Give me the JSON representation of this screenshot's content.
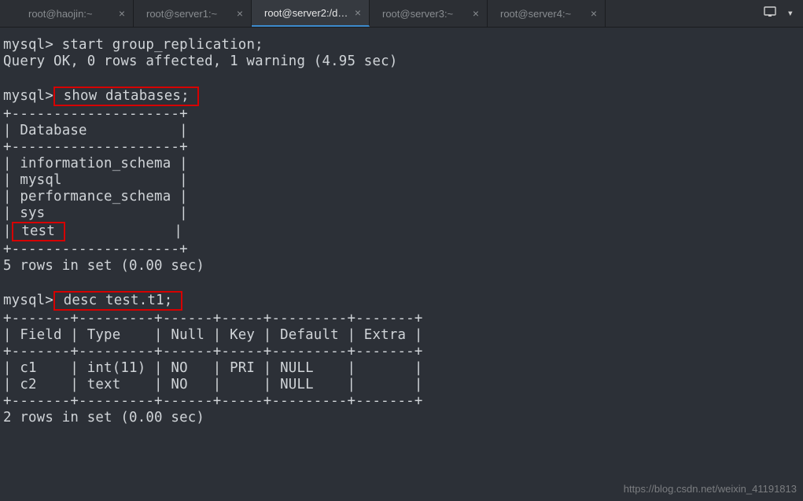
{
  "tabs": [
    {
      "label": "root@haojin:~",
      "active": false
    },
    {
      "label": "root@server1:~",
      "active": false
    },
    {
      "label": "root@server2:/d…",
      "active": true
    },
    {
      "label": "root@server3:~",
      "active": false
    },
    {
      "label": "root@server4:~",
      "active": false
    }
  ],
  "close_glyph": "×",
  "terminal": {
    "prompt": "mysql>",
    "cmd1": "start group_replication;",
    "resp1": "Query OK, 0 rows affected, 1 warning (4.95 sec)",
    "cmd2": " show databases; ",
    "db_border_top": "+--------------------+",
    "db_header": "| Database           |",
    "db_rows": [
      "| information_schema |",
      "| mysql              |",
      "| performance_schema |",
      "| sys                |"
    ],
    "db_row_test_pre": "|",
    "db_row_test_box": " test ",
    "db_row_test_post": "             |",
    "db_footer": "5 rows in set (0.00 sec)",
    "cmd3": " desc test.t1; ",
    "desc_border": "+-------+---------+------+-----+---------+-------+",
    "desc_header": "| Field | Type    | Null | Key | Default | Extra |",
    "desc_rows": [
      "| c1    | int(11) | NO   | PRI | NULL    |       |",
      "| c2    | text    | NO   |     | NULL    |       |"
    ],
    "desc_footer": "2 rows in set (0.00 sec)"
  },
  "watermark": "https://blog.csdn.net/weixin_41191813"
}
